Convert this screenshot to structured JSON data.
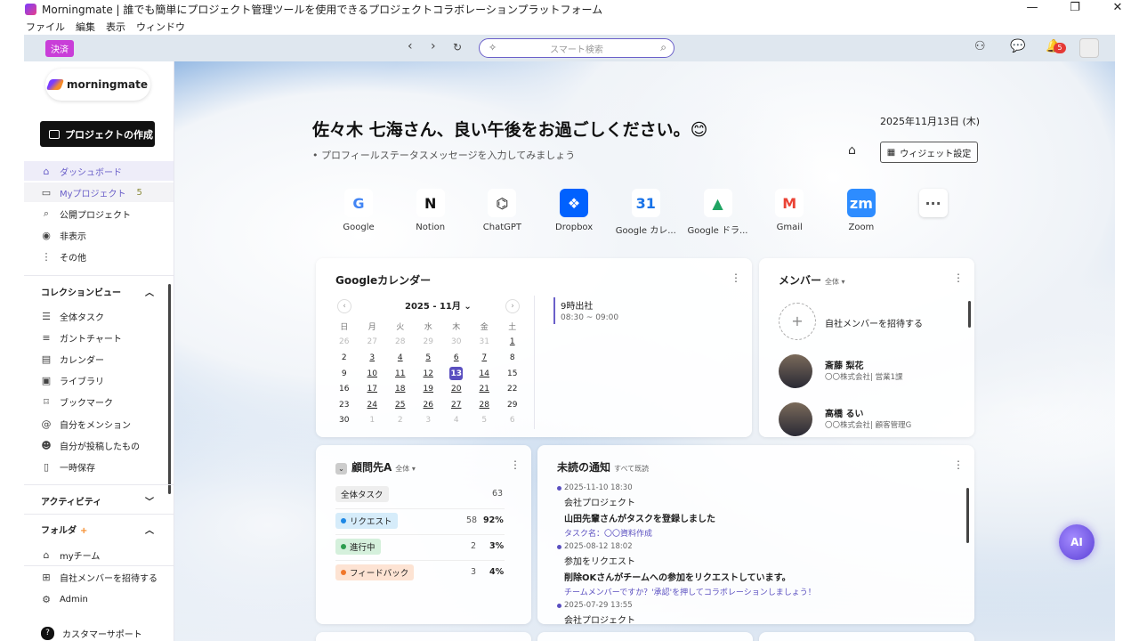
{
  "window": {
    "title": "Morningmate | 誰でも簡単にプロジェクト管理ツールを使用できるプロジェクトコラボレーションプラットフォーム",
    "menu": [
      "ファイル",
      "編集",
      "表示",
      "ウィンドウ"
    ]
  },
  "toolbar": {
    "pay_badge": "決済",
    "search_placeholder": "スマート検索",
    "notif_count": "5"
  },
  "sidebar": {
    "logo": "morningmate",
    "create_button": "プロジェクトの作成",
    "nav": [
      {
        "label": "ダッシュボード",
        "icon": "home-icon"
      },
      {
        "label": "Myプロジェクト",
        "count": "5",
        "icon": "project-icon"
      },
      {
        "label": "公開プロジェクト",
        "icon": "search-icon"
      },
      {
        "label": "非表示",
        "icon": "eye-icon"
      },
      {
        "label": "その他",
        "icon": "more-icon"
      }
    ],
    "collection_title": "コレクションビュー",
    "collection": [
      {
        "label": "全体タスク",
        "icon": "list-icon"
      },
      {
        "label": "ガントチャート",
        "icon": "gantt-icon"
      },
      {
        "label": "カレンダー",
        "icon": "calendar-icon"
      },
      {
        "label": "ライブラリ",
        "icon": "library-icon"
      },
      {
        "label": "ブックマーク",
        "icon": "bookmark-icon"
      },
      {
        "label": "自分をメンション",
        "icon": "mention-icon"
      },
      {
        "label": "自分が投稿したもの",
        "icon": "user-posts-icon"
      },
      {
        "label": "一時保存",
        "icon": "draft-icon"
      }
    ],
    "activity_title": "アクティビティ",
    "folder_title": "フォルダ",
    "folder_items": [
      {
        "label": "myチーム",
        "icon": "tag-icon"
      }
    ],
    "bottom": [
      {
        "label": "自社メンバーを招待する",
        "icon": "invite-icon"
      },
      {
        "label": "Admin",
        "icon": "admin-icon"
      }
    ],
    "support": "カスタマーサポート"
  },
  "main": {
    "greeting": "佐々木 七海さん、良い午後をお過ごしください。😊",
    "status_prompt": "プロフィールステータスメッセージを入力してみましょう",
    "date": "2025年11月13日 (木)",
    "widget_button": "ウィジェット設定",
    "shortcuts": [
      {
        "label": "Google",
        "glyph": "G",
        "color": "#4285f4",
        "bg": "#ffffff"
      },
      {
        "label": "Notion",
        "glyph": "N",
        "color": "#111111",
        "bg": "#ffffff"
      },
      {
        "label": "ChatGPT",
        "glyph": "⌬",
        "color": "#111111",
        "bg": "#ffffff"
      },
      {
        "label": "Dropbox",
        "glyph": "❖",
        "color": "#ffffff",
        "bg": "#0061fe"
      },
      {
        "label": "Google カレ...",
        "glyph": "31",
        "color": "#1a73e8",
        "bg": "#ffffff"
      },
      {
        "label": "Google ドラ...",
        "glyph": "▲",
        "color": "#1fa463",
        "bg": "#ffffff"
      },
      {
        "label": "Gmail",
        "glyph": "M",
        "color": "#ea4335",
        "bg": "#ffffff"
      },
      {
        "label": "Zoom",
        "glyph": "zm",
        "color": "#ffffff",
        "bg": "#2d8cff"
      },
      {
        "label": "",
        "glyph": "···",
        "color": "#555555",
        "bg": "#ffffff"
      }
    ]
  },
  "calendar": {
    "title": "Googleカレンダー",
    "month": "2025 - 11月",
    "dow": [
      "日",
      "月",
      "火",
      "水",
      "木",
      "金",
      "土"
    ],
    "weeks": [
      [
        "26",
        "27",
        "28",
        "29",
        "30",
        "31",
        "1"
      ],
      [
        "2",
        "3",
        "4",
        "5",
        "6",
        "7",
        "8"
      ],
      [
        "9",
        "10",
        "11",
        "12",
        "13",
        "14",
        "15"
      ],
      [
        "16",
        "17",
        "18",
        "19",
        "20",
        "21",
        "22"
      ],
      [
        "23",
        "24",
        "25",
        "26",
        "27",
        "28",
        "29"
      ],
      [
        "30",
        "1",
        "2",
        "3",
        "4",
        "5",
        "6"
      ]
    ],
    "today": "13",
    "event_title": "9時出社",
    "event_time": "08:30 ~ 09:00"
  },
  "members": {
    "title": "メンバー",
    "filter": "全体",
    "invite": "自社メンバーを招待する",
    "list": [
      {
        "name": "斎藤 梨花",
        "company": "〇〇株式会社",
        "dept": "営業1課"
      },
      {
        "name": "高橋 るい",
        "company": "〇〇株式会社",
        "dept": "顧客管理G"
      }
    ]
  },
  "client": {
    "title": "顧問先A",
    "filter": "全体",
    "total_label": "全体タスク",
    "total": "63",
    "rows": [
      {
        "label": "リクエスト",
        "count": "58",
        "pct": "92%",
        "bg": "#d6ecfa",
        "dot": "#1e88e5"
      },
      {
        "label": "進行中",
        "count": "2",
        "pct": "3%",
        "bg": "#d5f0dc",
        "dot": "#2e9d4f"
      },
      {
        "label": "フィードバック",
        "count": "3",
        "pct": "4%",
        "bg": "#fde3d3",
        "dot": "#f0772b"
      }
    ]
  },
  "notifications": {
    "title": "未読の通知",
    "read_all": "すべて既読",
    "items": [
      {
        "ts": "2025-11-10 18:30",
        "project": "会社プロジェクト",
        "msg": "山田先輩さんがタスクを登録しました",
        "detail": "タスク名：〇〇資料作成"
      },
      {
        "ts": "2025-08-12 18:02",
        "project": "参加をリクエスト",
        "msg": "削除OKさんがチームへの参加をリクエストしています。",
        "detail": "チームメンバーですか？'承認'を押してコラボレーションしましょう！"
      },
      {
        "ts": "2025-07-29 13:55",
        "project": "会社プロジェクト",
        "msg": "",
        "detail": ""
      }
    ]
  },
  "ai_button": "AI"
}
